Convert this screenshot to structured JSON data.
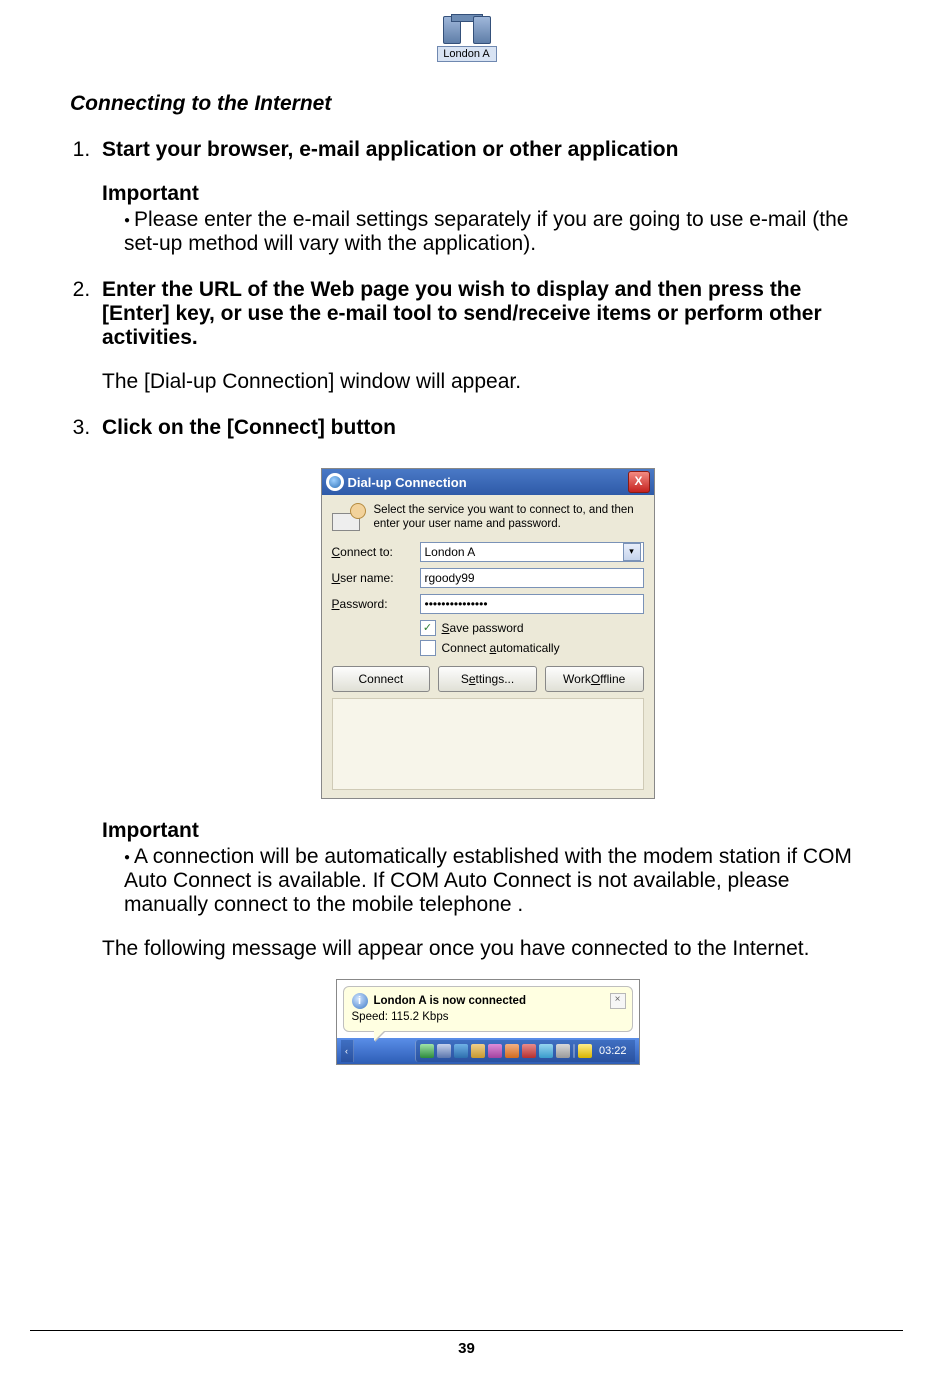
{
  "top_icon": {
    "label": "London A"
  },
  "section_title": "Connecting to the Internet",
  "steps": {
    "s1": {
      "title": "Start your browser, e-mail application or other application",
      "important_heading": "Important",
      "important_text": "Please enter the e-mail settings separately if you are going to use e-mail (the set-up method will vary with the application)."
    },
    "s2": {
      "title": "Enter the URL of the Web page you wish to display and then press the [Enter] key, or use the e-mail tool to send/receive items or perform other activities.",
      "after": "The [Dial-up Connection] window will appear."
    },
    "s3": {
      "title": "Click on the [Connect] button",
      "important_heading": "Important",
      "important_text": "A connection will be automatically established with the modem station if COM Auto Connect is available. If COM Auto Connect is not available, please manually connect to the mobile telephone .",
      "after": "The following message will appear once you have connected to the Internet."
    }
  },
  "dialog": {
    "title": "Dial-up Connection",
    "intro": "Select the service you want to connect to, and then enter your user name and password.",
    "labels": {
      "connect_to": "Connect to:",
      "user_name": "User name:",
      "password": "Password:"
    },
    "values": {
      "connect_to": "London A",
      "user_name": "rgoody99",
      "password_mask": "•••••••••••••••"
    },
    "checks": {
      "save_password": "Save password",
      "connect_auto": "Connect automatically",
      "save_password_checked": "✓",
      "connect_auto_checked": ""
    },
    "buttons": {
      "connect": "Connect",
      "settings": "Settings...",
      "offline": "Work Offline"
    },
    "close": "X"
  },
  "balloon": {
    "title": "London A is now connected",
    "speed": "Speed: 115.2 Kbps",
    "close": "×"
  },
  "tray": {
    "chev": "‹",
    "clock": "03:22"
  },
  "page_number": "39"
}
